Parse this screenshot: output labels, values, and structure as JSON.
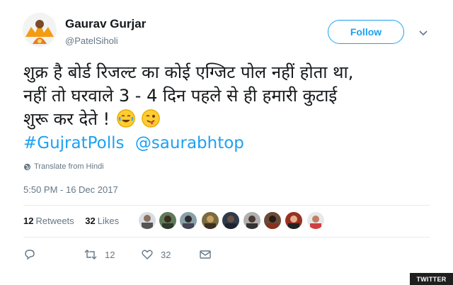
{
  "user": {
    "name": "Gaurav Gurjar",
    "handle": "@PatelSiholi"
  },
  "follow_label": "Follow",
  "tweet": {
    "line1": "शुक्र है बोर्ड रिजल्ट का कोई एग्जिट पोल नहीं होता था,",
    "line2": "नहीं तो घरवाले 3 - 4 दिन पहले से ही हमारी कुटाई",
    "line3": "शुरू कर देते !",
    "emojis": [
      "face-with-tears-of-joy-icon",
      "winking-face-with-tongue-icon"
    ],
    "hashtag": "#GujratPolls",
    "mention": "@saurabhtop"
  },
  "translate_label": "Translate from Hindi",
  "timestamp": "5:50 PM - 16 Dec 2017",
  "stats": {
    "retweets_count": "12",
    "retweets_label": "Retweets",
    "likes_count": "32",
    "likes_label": "Likes"
  },
  "actions": {
    "reply_count": "",
    "retweet_count": "12",
    "like_count": "32"
  },
  "badge": "TWITTER",
  "colors": {
    "link": "#1da1f2",
    "text": "#14171a",
    "muted": "#657786"
  }
}
